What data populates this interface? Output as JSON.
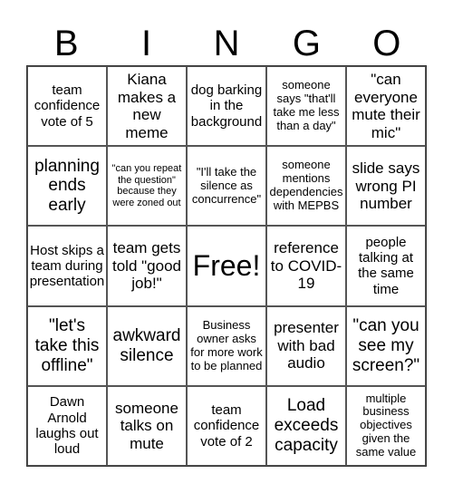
{
  "header": {
    "letters": [
      "B",
      "I",
      "N",
      "G",
      "O"
    ]
  },
  "grid": {
    "cells": [
      {
        "text": "team confidence vote of 5",
        "size": "md"
      },
      {
        "text": "Kiana makes a new meme",
        "size": "lg"
      },
      {
        "text": "dog barking in the background",
        "size": "md"
      },
      {
        "text": "someone says \"that'll take me less than a day\"",
        "size": "sm"
      },
      {
        "text": "\"can everyone mute their mic\"",
        "size": "lg"
      },
      {
        "text": "planning ends early",
        "size": "xl"
      },
      {
        "text": "\"can you repeat the question\" because they were zoned out",
        "size": "xs"
      },
      {
        "text": "\"I'll take the silence as concurrence\"",
        "size": "sm"
      },
      {
        "text": "someone mentions dependencies with MEPBS",
        "size": "sm"
      },
      {
        "text": "slide says wrong PI number",
        "size": "lg"
      },
      {
        "text": "Host skips a team during presentation",
        "size": "md"
      },
      {
        "text": "team gets told \"good job!\"",
        "size": "lg"
      },
      {
        "text": "Free!",
        "size": "free"
      },
      {
        "text": "reference to COVID-19",
        "size": "lg"
      },
      {
        "text": "people talking at the same time",
        "size": "md"
      },
      {
        "text": "\"let's take this offline\"",
        "size": "xl"
      },
      {
        "text": "awkward silence",
        "size": "xl"
      },
      {
        "text": "Business owner asks for more work to be planned",
        "size": "sm"
      },
      {
        "text": "presenter with bad audio",
        "size": "lg"
      },
      {
        "text": "\"can you see my screen?\"",
        "size": "xl"
      },
      {
        "text": "Dawn Arnold laughs out loud",
        "size": "md"
      },
      {
        "text": "someone talks on mute",
        "size": "lg"
      },
      {
        "text": "team confidence vote of 2",
        "size": "md"
      },
      {
        "text": "Load exceeds capacity",
        "size": "xl"
      },
      {
        "text": "multiple business objectives given the same value",
        "size": "sm"
      }
    ]
  }
}
